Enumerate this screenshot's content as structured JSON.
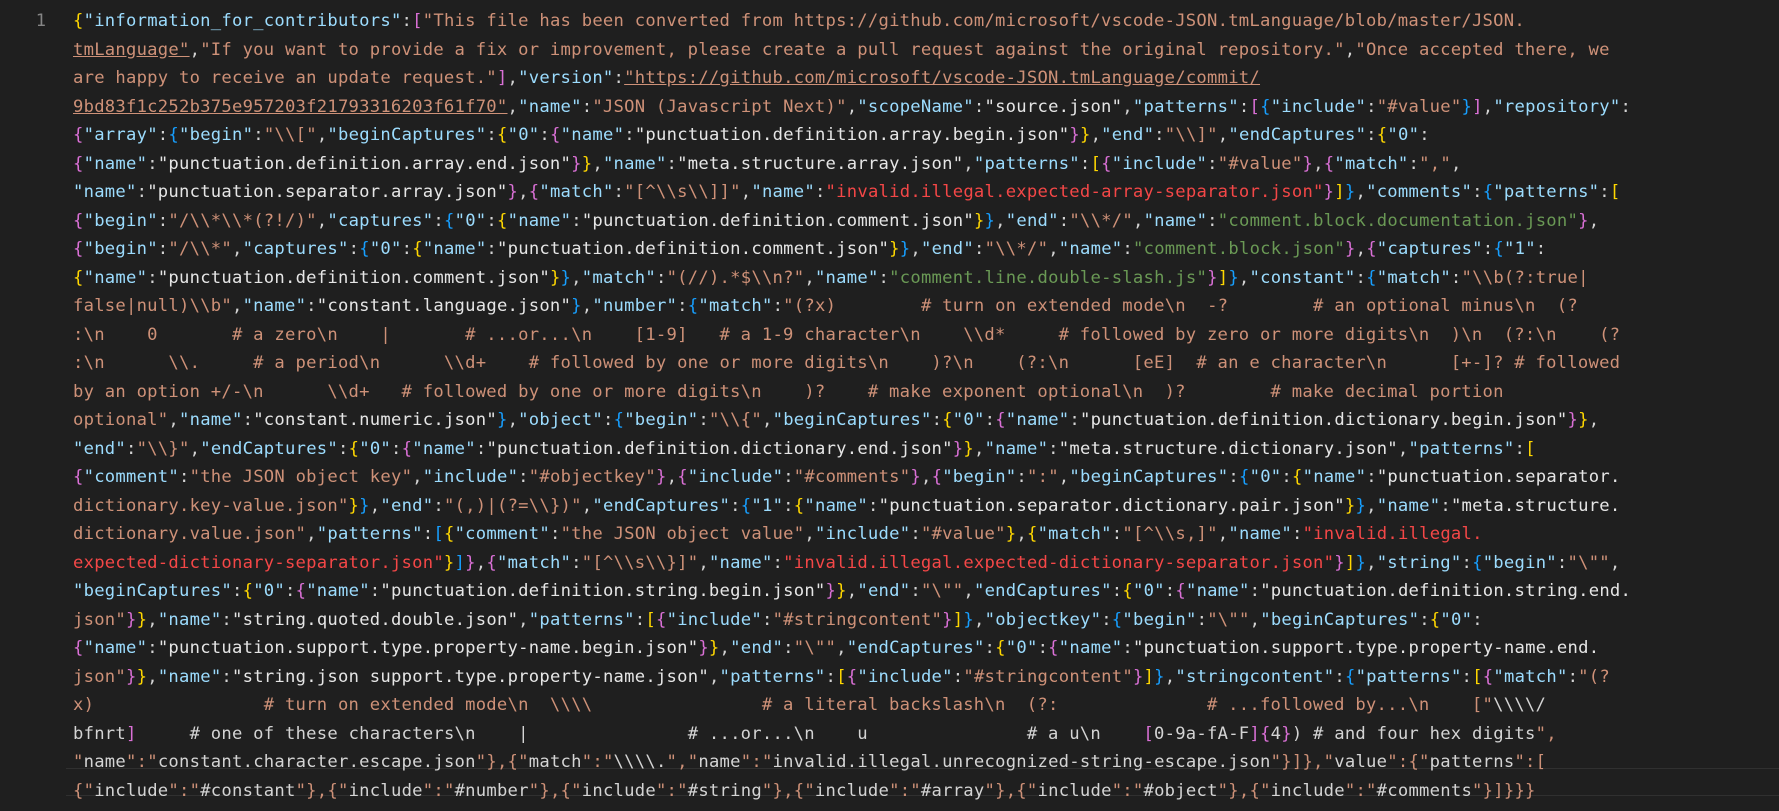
{
  "editor": {
    "line_number": "1",
    "language": "JSON",
    "colors": {
      "background": "#1f1f1f",
      "key": "#9cdcfe",
      "string": "#ce9178",
      "bracket_gold": "#ffd700",
      "bracket_purple": "#da70d6",
      "bracket_blue": "#179fff",
      "comment": "#6a9955",
      "invalid": "#f44747"
    },
    "visual_lines": [
      "{\"information_for_contributors\":[\"This file has been converted from https://github.com/microsoft/vscode-JSON.tmLanguage/blob/master/JSON.",
      "tmLanguage\",\"If you want to provide a fix or improvement, please create a pull request against the original repository.\",\"Once accepted there, we",
      "are happy to receive an update request.\"],\"version\":\"https://github.com/microsoft/vscode-JSON.tmLanguage/commit/",
      "9bd83f1c252b375e957203f21793316203f61f70\",\"name\":\"JSON (Javascript Next)\",\"scopeName\":\"source.json\",\"patterns\":[{\"include\":\"#value\"}],\"repository\":",
      "{\"array\":{\"begin\":\"\\\\[\",\"beginCaptures\":{\"0\":{\"name\":\"punctuation.definition.array.begin.json\"}},\"end\":\"\\\\]\",\"endCaptures\":{\"0\":",
      "{\"name\":\"punctuation.definition.array.end.json\"}},\"name\":\"meta.structure.array.json\",\"patterns\":[{\"include\":\"#value\"},{\"match\":\",\",",
      "\"name\":\"punctuation.separator.array.json\"},{\"match\":\"[^\\\\s\\\\]]\",\"name\":\"invalid.illegal.expected-array-separator.json\"}]},\"comments\":{\"patterns\":[",
      "{\"begin\":\"/\\\\*\\\\*(?!/)\",\"captures\":{\"0\":{\"name\":\"punctuation.definition.comment.json\"}},\"end\":\"\\\\*/\",\"name\":\"comment.block.documentation.json\"},",
      "{\"begin\":\"/\\\\*\",\"captures\":{\"0\":{\"name\":\"punctuation.definition.comment.json\"}},\"end\":\"\\\\*/\",\"name\":\"comment.block.json\"},{\"captures\":{\"1\":",
      "{\"name\":\"punctuation.definition.comment.json\"}},\"match\":\"(//).*$\\\\n?\",\"name\":\"comment.line.double-slash.js\"}]},\"constant\":{\"match\":\"\\\\b(?:true|",
      "false|null)\\\\b\",\"name\":\"constant.language.json\"},\"number\":{\"match\":\"(?x)        # turn on extended mode\\n  -?        # an optional minus\\n  (?",
      ":\\n    0       # a zero\\n    |       # ...or...\\n    [1-9]   # a 1-9 character\\n    \\\\d*     # followed by zero or more digits\\n  )\\n  (?:\\n    (?",
      ":\\n      \\\\.     # a period\\n      \\\\d+    # followed by one or more digits\\n    )?\\n    (?:\\n      [eE]  # an e character\\n      [+-]? # followed",
      "by an option +/-\\n      \\\\d+   # followed by one or more digits\\n    )?    # make exponent optional\\n  )?        # make decimal portion",
      "optional\",\"name\":\"constant.numeric.json\"},\"object\":{\"begin\":\"\\\\{\",\"beginCaptures\":{\"0\":{\"name\":\"punctuation.definition.dictionary.begin.json\"}},",
      "\"end\":\"\\\\}\",\"endCaptures\":{\"0\":{\"name\":\"punctuation.definition.dictionary.end.json\"}},\"name\":\"meta.structure.dictionary.json\",\"patterns\":[",
      "{\"comment\":\"the JSON object key\",\"include\":\"#objectkey\"},{\"include\":\"#comments\"},{\"begin\":\":\",\"beginCaptures\":{\"0\":{\"name\":\"punctuation.separator.",
      "dictionary.key-value.json\"}},\"end\":\"(,)|(?=\\\\})\",\"endCaptures\":{\"1\":{\"name\":\"punctuation.separator.dictionary.pair.json\"}},\"name\":\"meta.structure.",
      "dictionary.value.json\",\"patterns\":[{\"comment\":\"the JSON object value\",\"include\":\"#value\"},{\"match\":\"[^\\\\s,]\",\"name\":\"invalid.illegal.",
      "expected-dictionary-separator.json\"}]},{\"match\":\"[^\\\\s\\\\}]\",\"name\":\"invalid.illegal.expected-dictionary-separator.json\"}]},\"string\":{\"begin\":\"\\\"\",",
      "\"beginCaptures\":{\"0\":{\"name\":\"punctuation.definition.string.begin.json\"}},\"end\":\"\\\"\",\"endCaptures\":{\"0\":{\"name\":\"punctuation.definition.string.end.",
      "json\"}},\"name\":\"string.quoted.double.json\",\"patterns\":[{\"include\":\"#stringcontent\"}]},\"objectkey\":{\"begin\":\"\\\"\",\"beginCaptures\":{\"0\":",
      "{\"name\":\"punctuation.support.type.property-name.begin.json\"}},\"end\":\"\\\"\",\"endCaptures\":{\"0\":{\"name\":\"punctuation.support.type.property-name.end.",
      "json\"}},\"name\":\"string.json support.type.property-name.json\",\"patterns\":[{\"include\":\"#stringcontent\"}]},\"stringcontent\":{\"patterns\":[{\"match\":\"(?",
      "x)                # turn on extended mode\\n  \\\\\\\\                # a literal backslash\\n  (?:              # ...followed by...\\n    [\"\\\\\\\\/",
      "bfnrt]     # one of these characters\\n    |               # ...or...\\n    u               # a u\\n    [0-9a-fA-F]{4}) # and four hex digits\",",
      "\"name\":\"constant.character.escape.json\"},{\"match\":\"\\\\\\\\.\",\"name\":\"invalid.illegal.unrecognized-string-escape.json\"}]},\"value\":{\"patterns\":[",
      "{\"include\":\"#constant\"},{\"include\":\"#number\"},{\"include\":\"#string\"},{\"include\":\"#array\"},{\"include\":\"#object\"},{\"include\":\"#comments\"}]}}}"
    ]
  }
}
